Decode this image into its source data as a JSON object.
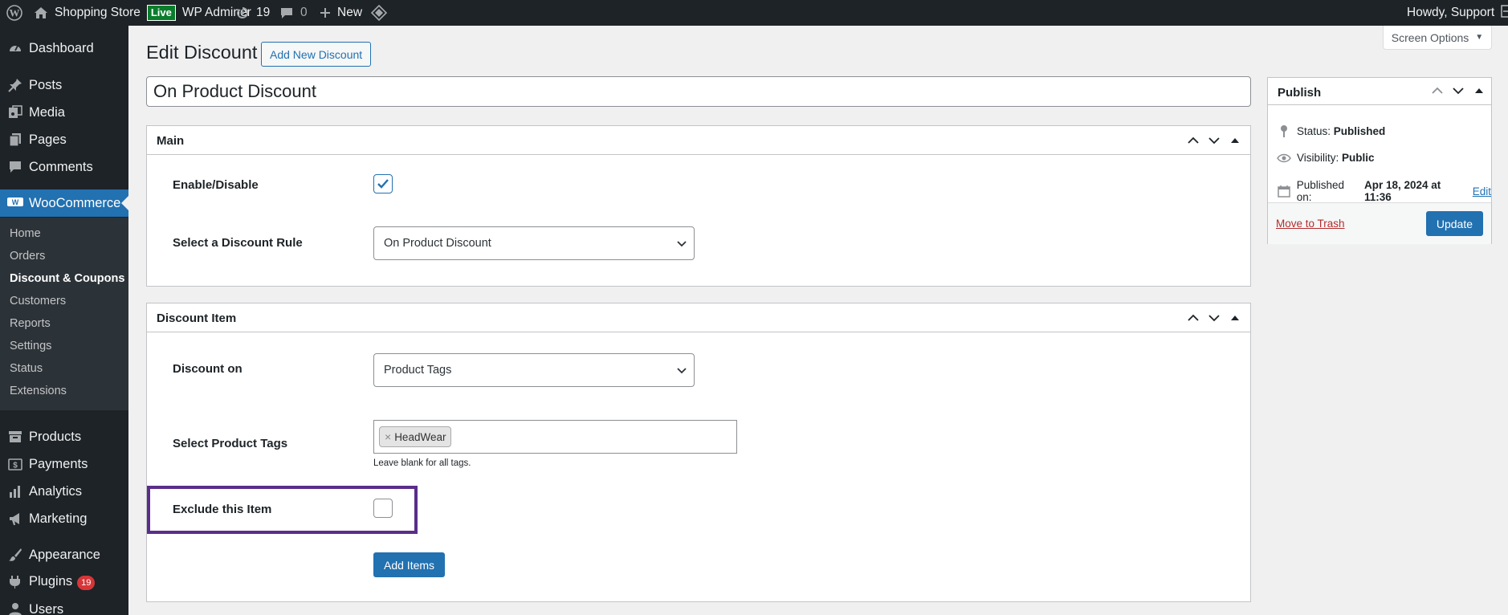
{
  "admin_bar": {
    "site_name": "Shopping Store",
    "live_badge": "Live",
    "site_user": "WP Adminer",
    "updates_count": "19",
    "comments_count": "0",
    "new_label": "New",
    "greeting": "Howdy, Support"
  },
  "sidebar": {
    "dashboard": "Dashboard",
    "posts": "Posts",
    "media": "Media",
    "pages": "Pages",
    "comments": "Comments",
    "woocommerce": "WooCommerce",
    "submenu": [
      "Home",
      "Orders",
      "Discount & Coupons",
      "Customers",
      "Reports",
      "Settings",
      "Status",
      "Extensions"
    ],
    "products": "Products",
    "payments": "Payments",
    "analytics": "Analytics",
    "marketing": "Marketing",
    "appearance": "Appearance",
    "plugins": "Plugins",
    "plugins_badge": "19",
    "users": "Users"
  },
  "header": {
    "screen_options": "Screen Options",
    "page_title": "Edit Discount",
    "add_new_button": "Add New Discount",
    "post_title_value": "On Product Discount"
  },
  "main_box": {
    "title": "Main",
    "enable_label": "Enable/Disable",
    "enable_checked": true,
    "rule_label": "Select a Discount Rule",
    "rule_value": "On Product Discount"
  },
  "discount_item_box": {
    "title": "Discount Item",
    "discount_on_label": "Discount on",
    "discount_on_value": "Product Tags",
    "tags_label": "Select Product Tags",
    "tags": [
      "HeadWear"
    ],
    "tags_help": "Leave blank for all tags.",
    "exclude_label": "Exclude this Item",
    "exclude_checked": false,
    "add_items_button": "Add Items"
  },
  "publish_box": {
    "title": "Publish",
    "status_label": "Status:",
    "status_value": "Published",
    "visibility_label": "Visibility:",
    "visibility_value": "Public",
    "published_label": "Published on:",
    "published_value": "Apr 18, 2024 at 11:36",
    "edit_link": "Edit",
    "trash_link": "Move to Trash",
    "update_button": "Update"
  },
  "colors": {
    "admin_dark": "#1d2327",
    "accent_blue": "#2271b1",
    "highlight_purple": "#5b2d8a",
    "badge_red": "#d63638"
  }
}
